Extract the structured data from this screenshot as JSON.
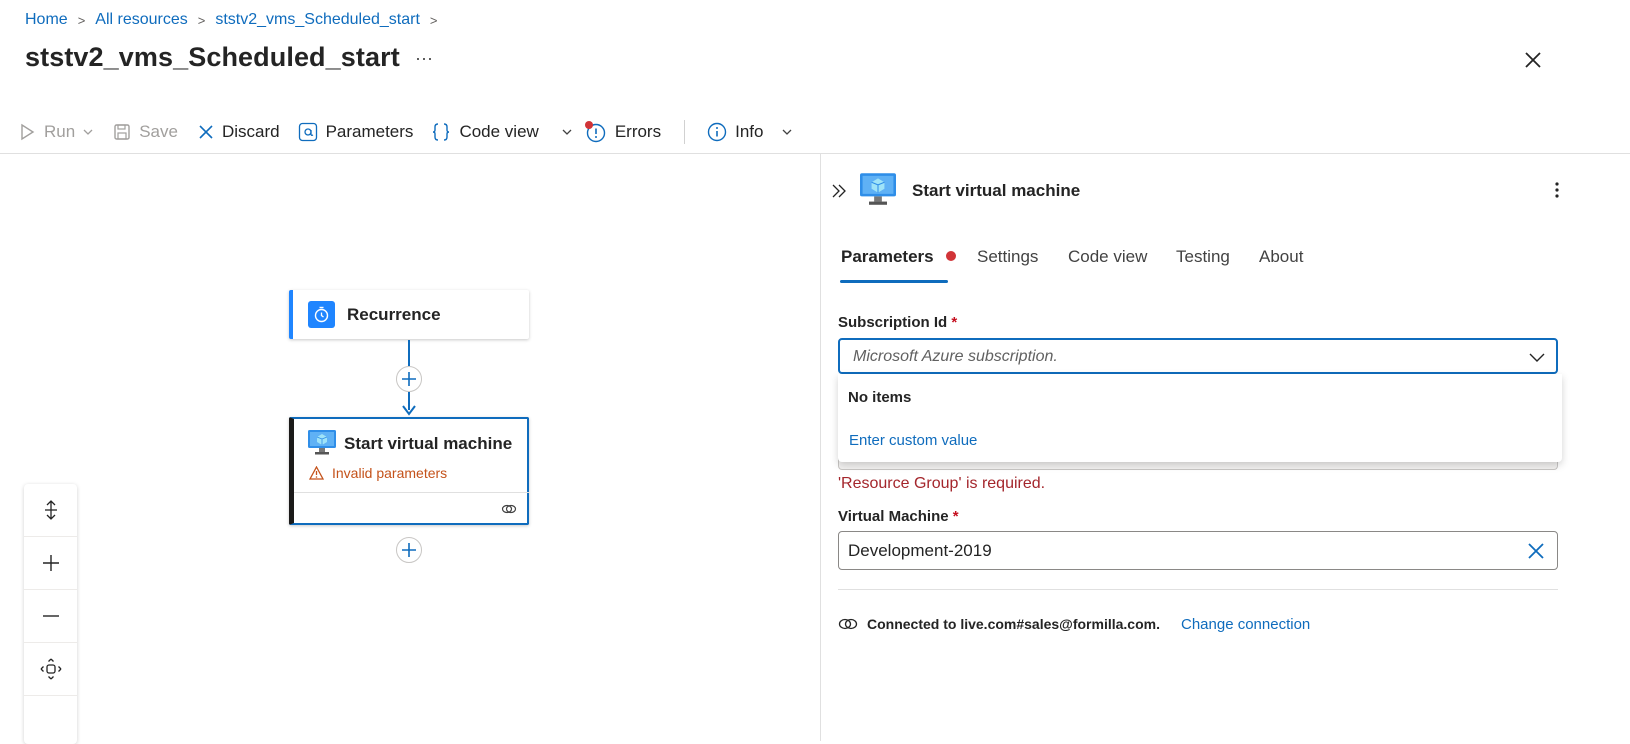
{
  "breadcrumb": {
    "items": [
      "Home",
      "All resources",
      "ststv2_vms_Scheduled_start"
    ]
  },
  "header": {
    "title": "ststv2_vms_Scheduled_start",
    "more": "···"
  },
  "toolbar": {
    "run": "Run",
    "save": "Save",
    "discard": "Discard",
    "parameters": "Parameters",
    "code_view": "Code view",
    "errors": "Errors",
    "info": "Info"
  },
  "canvas": {
    "recurrence_title": "Recurrence",
    "startvm_title": "Start virtual machine",
    "startvm_warning": "Invalid parameters"
  },
  "panel": {
    "title": "Start virtual machine",
    "tabs": [
      "Parameters",
      "Settings",
      "Code view",
      "Testing",
      "About"
    ],
    "subscription": {
      "label": "Subscription Id",
      "required_mark": "*",
      "placeholder": "Microsoft Azure subscription."
    },
    "dropdown": {
      "no_items": "No items",
      "custom_value": "Enter custom value"
    },
    "resource_group_error": "'Resource Group' is required.",
    "virtual_machine": {
      "label": "Virtual Machine",
      "required_mark": "*",
      "value": "Development-2019"
    },
    "connection": {
      "text": "Connected to live.com#sales@formilla.com.",
      "change": "Change connection"
    }
  },
  "colors": {
    "accent": "#0f6cbd",
    "error": "#a4262c",
    "warning": "#c4521a",
    "error_dot": "#d13438"
  }
}
